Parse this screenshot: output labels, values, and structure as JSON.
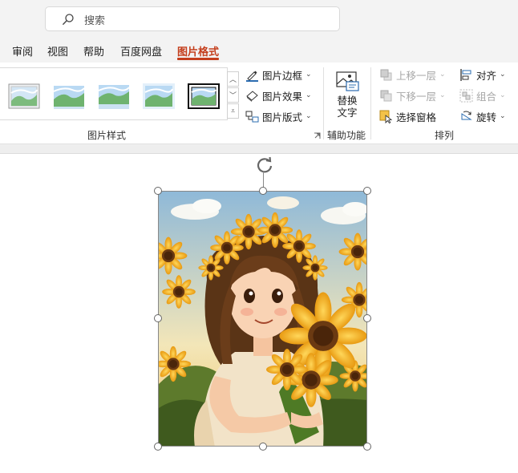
{
  "search": {
    "placeholder": "搜索",
    "icon": "search-icon"
  },
  "tabs": [
    {
      "label": "审阅"
    },
    {
      "label": "视图"
    },
    {
      "label": "帮助"
    },
    {
      "label": "百度网盘"
    },
    {
      "label": "图片格式",
      "active": true
    }
  ],
  "ribbon": {
    "picture_styles": {
      "label": "图片样式",
      "border": "图片边框",
      "effects": "图片效果",
      "layout": "图片版式"
    },
    "accessibility": {
      "label": "辅助功能",
      "alt_text_line1": "替换",
      "alt_text_line2": "文字"
    },
    "arrange": {
      "label": "排列",
      "bring_forward": "上移一层",
      "send_backward": "下移一层",
      "selection_pane": "选择窗格",
      "align": "对齐",
      "group": "组合",
      "rotate": "旋转"
    }
  },
  "colors": {
    "accent": "#c43e1c",
    "disabled_text": "#a6a6a6",
    "icon_blue": "#2b6cb0"
  }
}
